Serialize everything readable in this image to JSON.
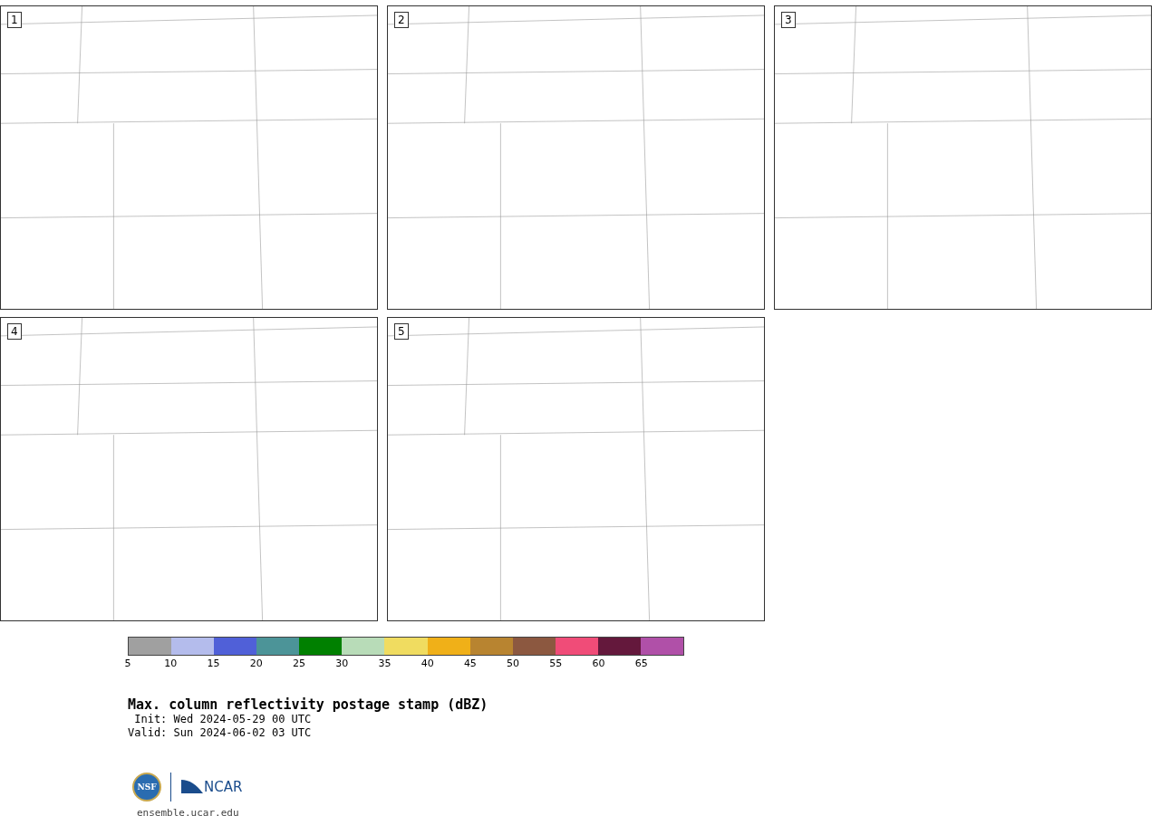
{
  "panels": [
    {
      "label": "1"
    },
    {
      "label": "2"
    },
    {
      "label": "3"
    },
    {
      "label": "4"
    },
    {
      "label": "5"
    }
  ],
  "colorbar": {
    "segments": [
      {
        "color": "#a0a0a0"
      },
      {
        "color": "#b4bcec"
      },
      {
        "color": "#5060d8"
      },
      {
        "color": "#4c9498"
      },
      {
        "color": "#008000"
      },
      {
        "color": "#b8dcb8"
      },
      {
        "color": "#f0dc60"
      },
      {
        "color": "#f0b018"
      },
      {
        "color": "#b88430"
      },
      {
        "color": "#8c5840"
      },
      {
        "color": "#f04c78"
      },
      {
        "color": "#64183c"
      },
      {
        "color": "#b050a8"
      }
    ],
    "ticks": [
      "5",
      "10",
      "15",
      "20",
      "25",
      "30",
      "35",
      "40",
      "45",
      "50",
      "55",
      "60",
      "65"
    ]
  },
  "title": "Max. column reflectivity postage stamp (dBZ)",
  "init": " Init: Wed 2024-05-29 00 UTC",
  "valid": "Valid: Sun 2024-06-02 03 UTC",
  "logos": {
    "nsf": "NSF",
    "ncar": "NCAR"
  },
  "footer_link": "ensemble.ucar.edu"
}
